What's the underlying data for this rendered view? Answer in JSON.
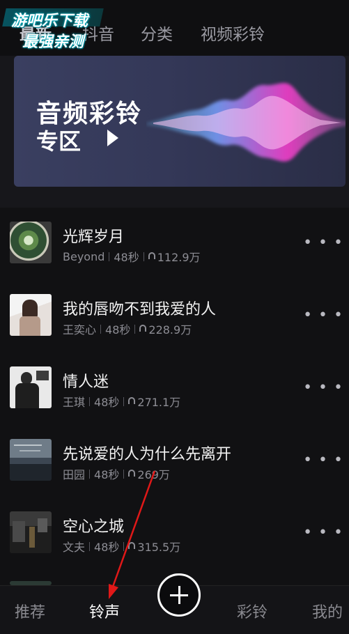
{
  "watermark": {
    "line1": "游吧乐下载",
    "line2": "最强亲测"
  },
  "top_tabs": [
    "最新",
    "抖音",
    "分类",
    "视频彩铃"
  ],
  "banner": {
    "title": "音频彩铃",
    "subtitle": "专区"
  },
  "songs": [
    {
      "title": "光辉岁月",
      "artist": "Beyond",
      "duration": "48秒",
      "plays": "112.9万"
    },
    {
      "title": "我的唇吻不到我爱的人",
      "artist": "王奕心",
      "duration": "48秒",
      "plays": "228.9万"
    },
    {
      "title": "情人迷",
      "artist": "王琪",
      "duration": "48秒",
      "plays": "271.1万"
    },
    {
      "title": "先说爱的人为什么先离开",
      "artist": "田园",
      "duration": "48秒",
      "plays": "269万"
    },
    {
      "title": "空心之城",
      "artist": "文夫",
      "duration": "48秒",
      "plays": "315.5万"
    }
  ],
  "more_label": "• • •",
  "bottom_nav": {
    "recommend": "推荐",
    "ringtone": "铃声",
    "crbt": "彩铃",
    "mine": "我的"
  },
  "colors": {
    "background": "#111113",
    "annotation_arrow": "#e01818",
    "wave_pink": "#ff3fd2",
    "wave_blue": "#5aa8ff"
  }
}
